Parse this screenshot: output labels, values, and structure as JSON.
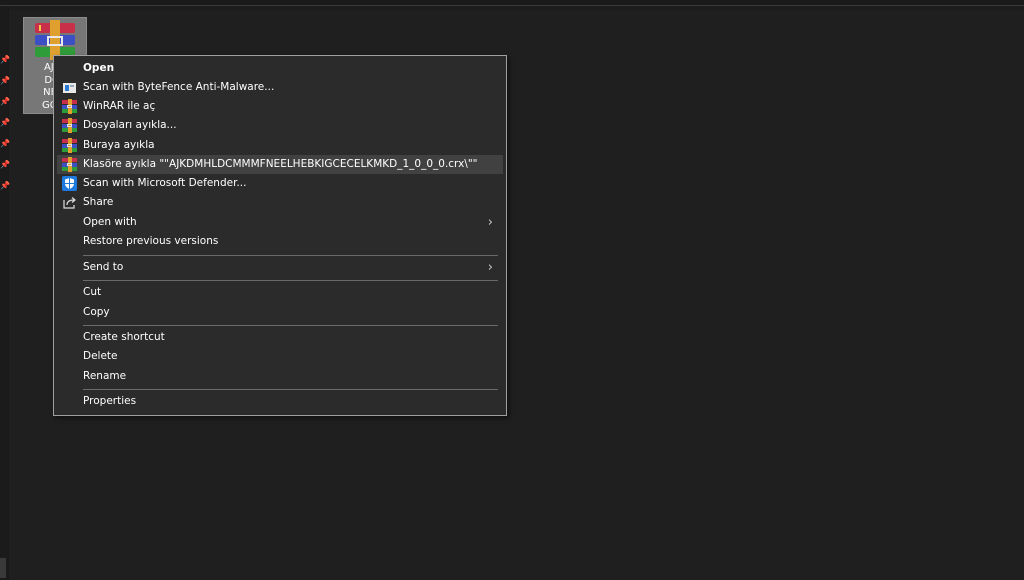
{
  "desktop": {
    "file": {
      "name_lines": [
        "AJKD",
        "DCM",
        "NEEL",
        "GCEC"
      ],
      "icon": "winrar-archive-icon"
    },
    "nav_pins_count": 7
  },
  "context_menu": {
    "items": [
      {
        "label": "Open",
        "bold": true,
        "icon": null
      },
      {
        "label": "Scan with ByteFence Anti-Malware...",
        "icon": "bytefence-icon"
      },
      {
        "label": "WinRAR ile aç",
        "icon": "winrar-icon"
      },
      {
        "label": "Dosyaları ayıkla...",
        "icon": "winrar-icon"
      },
      {
        "label": "Buraya ayıkla",
        "icon": "winrar-icon"
      },
      {
        "label": "Klasöre ayıkla \"\"AJKDMHLDCMMMFNEELHEBKIGCECELKMKD_1_0_0_0.crx\\\"\"",
        "icon": "winrar-icon",
        "highlighted": true
      },
      {
        "label": "Scan with Microsoft Defender...",
        "icon": "defender-shield-icon"
      },
      {
        "label": "Share",
        "icon": "share-icon"
      },
      {
        "label": "Open with",
        "submenu": true
      },
      {
        "label": "Restore previous versions"
      },
      {
        "label": "Send to",
        "submenu": true
      },
      {
        "label": "Cut"
      },
      {
        "label": "Copy"
      },
      {
        "label": "Create shortcut"
      },
      {
        "label": "Delete"
      },
      {
        "label": "Rename"
      },
      {
        "label": "Properties"
      }
    ],
    "submenu_glyph": "›"
  }
}
